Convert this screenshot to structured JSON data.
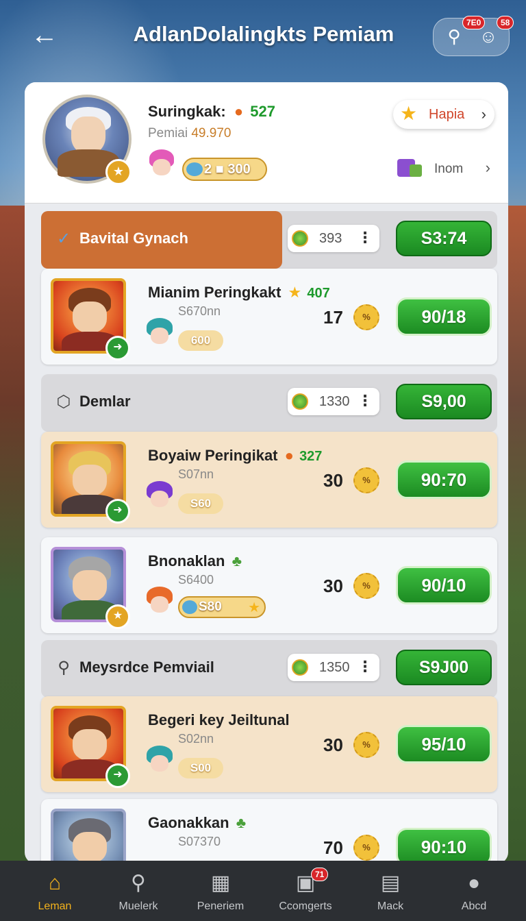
{
  "header": {
    "title": "AdlanDolalingkts Pemiam",
    "back_icon": "back-arrow-icon",
    "badge_left": "7E0",
    "badge_right": "58"
  },
  "profile": {
    "name": "Suringkak:",
    "name_value": "527",
    "sub_label": "Pemiai",
    "sub_value": "49.970",
    "currency_a": "2",
    "currency_b": "300",
    "hapia_label": "Hapia",
    "inom_label": "Inom"
  },
  "sections": [
    {
      "label": "Bavital Gynach",
      "stat": "393",
      "price": "S3:74",
      "cards": [
        {
          "name": "Mianim Peringkakt",
          "name_value": "407",
          "sub": "S670nn",
          "pill": "600",
          "count": "17",
          "button": "90/18"
        }
      ]
    },
    {
      "label": "Demlar",
      "stat": "1330",
      "price": "S9,00",
      "cards": [
        {
          "name": "Boyaiw Peringikat",
          "name_value": "327",
          "sub": "S07nn",
          "pill": "S60",
          "count": "30",
          "button": "90:70"
        },
        {
          "name": "Bnonaklan",
          "name_value": "",
          "sub": "S6400",
          "pill": "S80",
          "count": "30",
          "button": "90/10"
        }
      ]
    },
    {
      "label": "Meysrdce Pemviail",
      "stat": "1350",
      "price": "S9J00",
      "cards": [
        {
          "name": "Begeri key Jeiltunal",
          "name_value": "",
          "sub": "S02nn",
          "pill": "S00",
          "count": "30",
          "button": "95/10"
        },
        {
          "name": "Gaonakkan",
          "name_value": "",
          "sub": "S07370",
          "pill": "",
          "count": "70",
          "button": "90:10"
        }
      ]
    }
  ],
  "badge_text": "%",
  "nav": [
    {
      "label": "Leman",
      "icon": "home-icon",
      "active": true
    },
    {
      "label": "Muelerk",
      "icon": "search-icon",
      "active": false
    },
    {
      "label": "Peneriem",
      "icon": "grid-icon",
      "active": false
    },
    {
      "label": "Ccomgerts",
      "icon": "chest-icon",
      "active": false,
      "badge": "71"
    },
    {
      "label": "Mack",
      "icon": "inventory-icon",
      "active": false
    },
    {
      "label": "Abcd",
      "icon": "profile-icon",
      "active": false
    }
  ],
  "colors": {
    "accent_green": "#1e9a2c",
    "accent_orange": "#cc6f34",
    "active_nav": "#f3b21c"
  }
}
